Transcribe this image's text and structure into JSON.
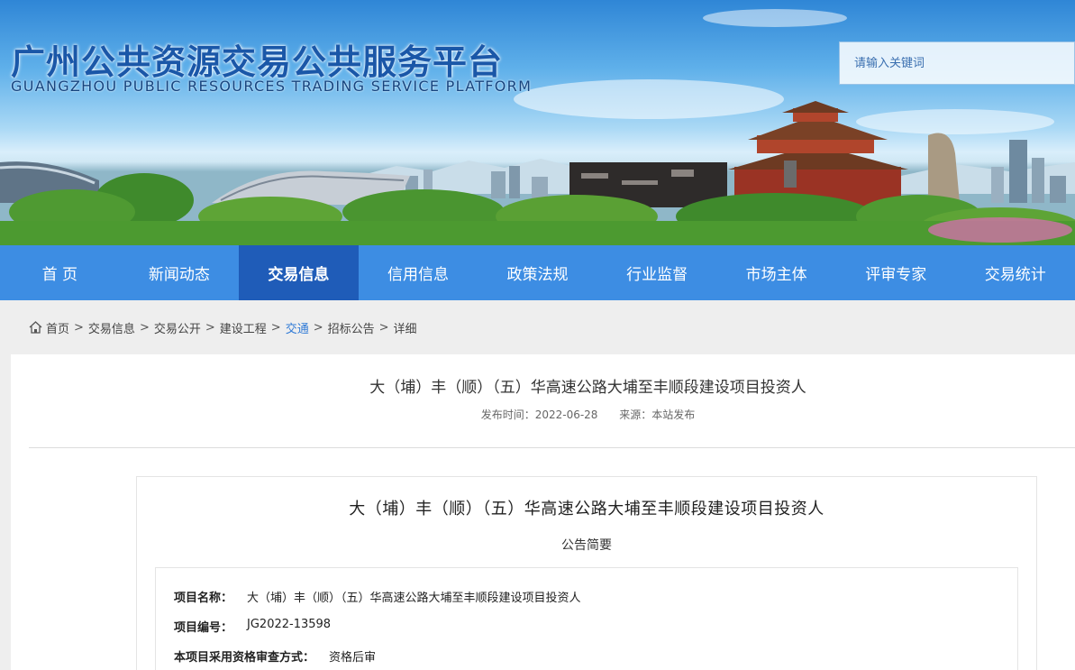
{
  "header": {
    "title": "广州公共资源交易公共服务平台",
    "subtitle": "GUANGZHOU PUBLIC RESOURCES TRADING SERVICE PLATFORM",
    "search_placeholder": "请输入关键词"
  },
  "nav": {
    "items": [
      {
        "label": "首 页"
      },
      {
        "label": "新闻动态"
      },
      {
        "label": "交易信息"
      },
      {
        "label": "信用信息"
      },
      {
        "label": "政策法规"
      },
      {
        "label": "行业监督"
      },
      {
        "label": "市场主体"
      },
      {
        "label": "评审专家"
      },
      {
        "label": "交易统计"
      }
    ],
    "active": "交易信息"
  },
  "breadcrumb": {
    "items": [
      "首页",
      "交易信息",
      "交易公开",
      "建设工程",
      "交通",
      "招标公告",
      "详细"
    ],
    "separator": ">"
  },
  "article": {
    "title": "大（埔）丰（顺）（五）华高速公路大埔至丰顺段建设项目投资人",
    "publish_label": "发布时间：",
    "publish_date": "2022-06-28",
    "source_label": "来源：",
    "source": "本站发布"
  },
  "document": {
    "title": "大（埔）丰（顺）（五）华高速公路大埔至丰顺段建设项目投资人",
    "subtitle": "公告简要",
    "fields": [
      {
        "label": "项目名称：",
        "value": "大（埔）丰（顺）（五）华高速公路大埔至丰顺段建设项目投资人"
      },
      {
        "label": "项目编号：",
        "value": "JG2022-13598"
      },
      {
        "label": "本项目采用资格审查方式：",
        "value": "资格后审"
      }
    ]
  },
  "colors": {
    "nav_bg": "#3d8de3",
    "nav_active": "#1f5cb8",
    "title_blue": "#1a57a8",
    "link_highlight": "#2f7ad6"
  }
}
